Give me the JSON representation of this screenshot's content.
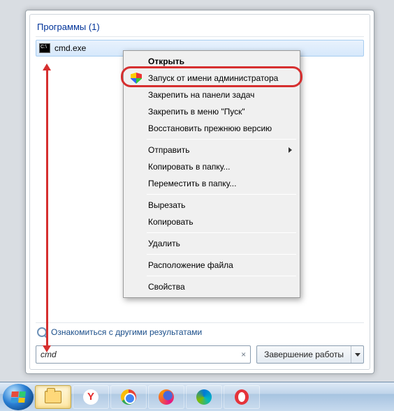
{
  "results": {
    "group_header": "Программы (1)",
    "item_label": "cmd.exe"
  },
  "more_results": "Ознакомиться с другими результатами",
  "search": {
    "value": "cmd",
    "clear_glyph": "×"
  },
  "shutdown_label": "Завершение работы",
  "context_menu": {
    "open": "Открыть",
    "run_admin": "Запуск от имени администратора",
    "pin_taskbar": "Закрепить на панели задач",
    "pin_start": "Закрепить в меню \"Пуск\"",
    "restore_prev": "Восстановить прежнюю версию",
    "send_to": "Отправить",
    "copy_to": "Копировать в папку...",
    "move_to": "Переместить в папку...",
    "cut": "Вырезать",
    "copy": "Копировать",
    "delete": "Удалить",
    "file_location": "Расположение файла",
    "properties": "Свойства"
  },
  "taskbar": {
    "yandex_glyph": "Y"
  }
}
